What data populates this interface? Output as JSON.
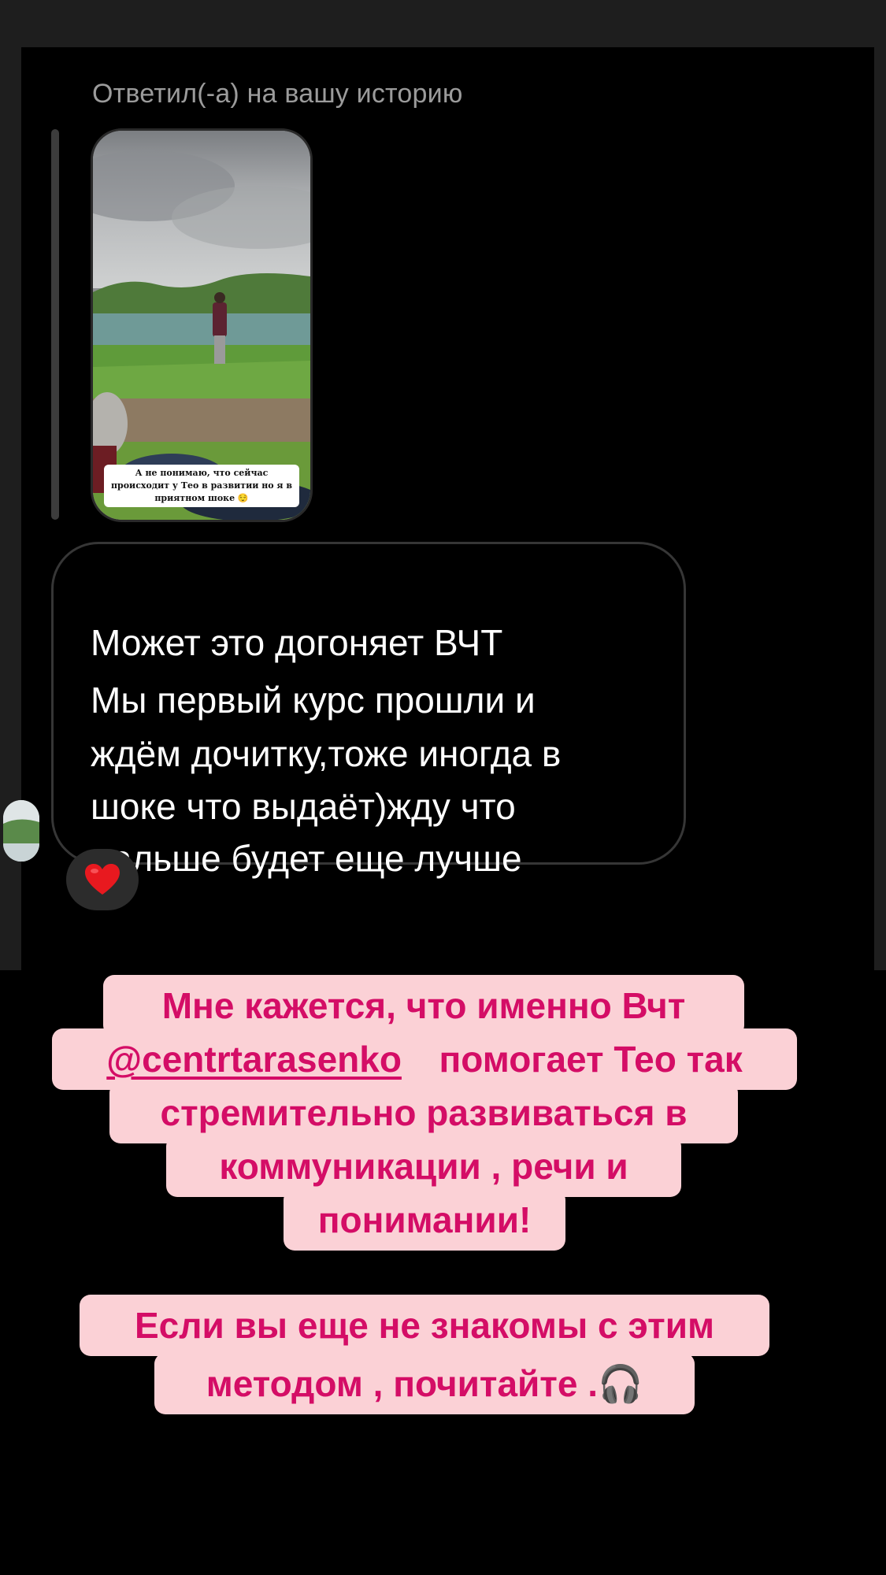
{
  "reply": {
    "header": "Ответил(-а) на вашу историю",
    "story_caption": "А не понимаю, что сейчас происходит у Тео в развитии но я в приятном шоке 😌"
  },
  "message": {
    "lines": [
      "Может это догоняет ВЧТ",
      "Мы первый курс прошли и",
      "ждём дочитку,тоже иногда в",
      "шоке что выдаёт)жду что",
      "дальше будет еще лучше"
    ],
    "reaction": "❤️"
  },
  "overlay": {
    "block1": {
      "line1": "Мне кажется, что именно Вчт",
      "line2_mention": "@centrtarasenko",
      "line2_rest": "помогает Тео так",
      "line3": "стремительно развиваться в",
      "line4": "коммуникации , речи и",
      "line5": "понимании!"
    },
    "block2": {
      "line1": "Если вы еще не знакомы с этим",
      "line2": "методом , почитайте .🎧"
    }
  },
  "colors": {
    "highlight_bg": "#fbd1d6",
    "highlight_text": "#d40d66",
    "background": "#000000",
    "frame": "#1e1e1e"
  },
  "icons": [
    "red-heart-reaction-icon",
    "headphones-icon"
  ]
}
